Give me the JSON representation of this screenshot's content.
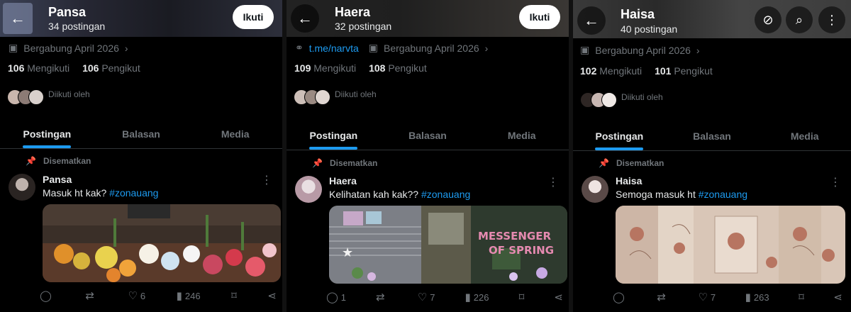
{
  "panels": [
    {
      "header": {
        "title": "Pansa",
        "subtitle": "34 postingan",
        "follow_label": "Ikuti"
      },
      "meta": {
        "joined": "Bergabung April 2026"
      },
      "stats": {
        "following_count": "106",
        "following_label": "Mengikuti",
        "followers_count": "106",
        "followers_label": "Pengikut"
      },
      "followed_by": "Diikuti oleh",
      "tabs": [
        "Postingan",
        "Balasan",
        "Media"
      ],
      "pinned_label": "Disematkan",
      "post": {
        "name": "Pansa",
        "text": "Masuk ht kak?",
        "hashtag": "#zonauang",
        "likes": "6",
        "views": "246",
        "replies": "",
        "retweets": ""
      }
    },
    {
      "header": {
        "title": "Haera",
        "subtitle": "32 postingan",
        "follow_label": "Ikuti"
      },
      "meta": {
        "link": "t.me/narvta",
        "joined": "Bergabung April 2026"
      },
      "stats": {
        "following_count": "109",
        "following_label": "Mengikuti",
        "followers_count": "108",
        "followers_label": "Pengikut"
      },
      "followed_by": "Diikuti oleh",
      "tabs": [
        "Postingan",
        "Balasan",
        "Media"
      ],
      "pinned_label": "Disematkan",
      "post": {
        "name": "Haera",
        "text": "Kelihatan kah kak??",
        "hashtag": "#zonauang",
        "likes": "7",
        "views": "226",
        "replies": "1",
        "retweets": ""
      }
    },
    {
      "header": {
        "title": "Haisa",
        "subtitle": "40 postingan"
      },
      "meta": {
        "joined": "Bergabung April 2026"
      },
      "stats": {
        "following_count": "102",
        "following_label": "Mengikuti",
        "followers_count": "101",
        "followers_label": "Pengikut"
      },
      "followed_by": "Diikuti oleh",
      "tabs": [
        "Postingan",
        "Balasan",
        "Media"
      ],
      "pinned_label": "Disematkan",
      "post": {
        "name": "Haisa",
        "text": "Semoga masuk ht",
        "hashtag": "#zonauang",
        "likes": "7",
        "views": "263",
        "replies": "",
        "retweets": ""
      }
    }
  ],
  "icons": {
    "back": "arrow-left-icon",
    "calendar": "calendar-icon",
    "chevron": "chevron-right-icon",
    "link": "link-icon",
    "pin": "pin-icon",
    "more": "more-vertical-icon",
    "reply": "reply-icon",
    "retweet": "retweet-icon",
    "like": "heart-icon",
    "views": "views-chart-icon",
    "bookmark": "bookmark-icon",
    "share": "share-icon",
    "unfollow-sync": "sync-slash-icon",
    "search": "search-icon"
  },
  "colors": {
    "accent": "#1d9bf0",
    "text": "#e7e9ea",
    "muted": "#71767b",
    "background": "#000000"
  }
}
